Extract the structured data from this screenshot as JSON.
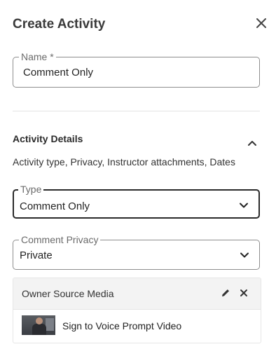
{
  "header": {
    "title": "Create Activity",
    "close_icon": "close-icon"
  },
  "name_field": {
    "label": "Name *",
    "value": "Comment Only"
  },
  "details": {
    "title": "Activity Details",
    "subtitle": "Activity type, Privacy, Instructor attachments, Dates",
    "toggle_icon": "chevron-up-icon"
  },
  "type_field": {
    "label": "Type",
    "value": "Comment Only",
    "icon": "chevron-down-icon"
  },
  "privacy_field": {
    "label": "Comment Privacy",
    "value": "Private",
    "icon": "chevron-down-icon"
  },
  "media": {
    "title": "Owner Source Media",
    "edit_icon": "pencil-icon",
    "remove_icon": "close-icon",
    "item_label": "Sign to Voice Prompt Video"
  }
}
